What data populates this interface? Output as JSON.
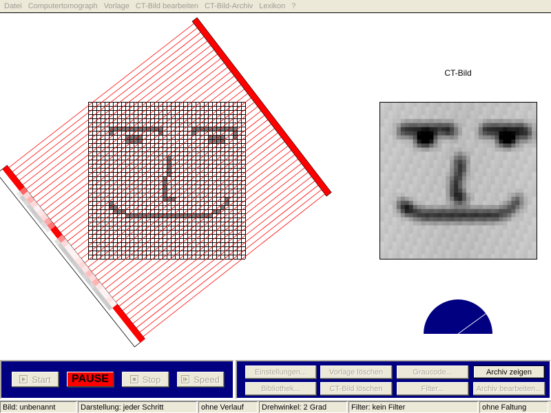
{
  "menu": [
    "Datei",
    "Computertomograph",
    "Vorlage",
    "CT-Bild bearbeiten",
    "CT-Bild-Archiv",
    "Lexikon",
    "?"
  ],
  "ct_title": "CT-Bild",
  "colors": {
    "ray": "#ff0000",
    "emitter": "#ff0000",
    "panel": "#000080",
    "grid_fill": "#808080",
    "gauge": "#000080"
  },
  "scanner": {
    "rotation_angle_deg": 2,
    "grid_size": 38,
    "face_pixels": [
      [
        6,
        5
      ],
      [
        6,
        6
      ],
      [
        6,
        7
      ],
      [
        6,
        8
      ],
      [
        6,
        9
      ],
      [
        6,
        10
      ],
      [
        6,
        11
      ],
      [
        6,
        12
      ],
      [
        6,
        13
      ],
      [
        6,
        14
      ],
      [
        6,
        15
      ],
      [
        6,
        16
      ],
      [
        6,
        17
      ],
      [
        7,
        5
      ],
      [
        7,
        17
      ],
      [
        8,
        9
      ],
      [
        8,
        10
      ],
      [
        8,
        11
      ],
      [
        9,
        9
      ],
      [
        9,
        10
      ],
      [
        9,
        11
      ],
      [
        9,
        12
      ],
      [
        8,
        12
      ],
      [
        6,
        25
      ],
      [
        6,
        26
      ],
      [
        6,
        27
      ],
      [
        6,
        28
      ],
      [
        6,
        29
      ],
      [
        6,
        30
      ],
      [
        6,
        31
      ],
      [
        6,
        32
      ],
      [
        6,
        33
      ],
      [
        6,
        34
      ],
      [
        6,
        35
      ],
      [
        7,
        25
      ],
      [
        7,
        35
      ],
      [
        8,
        35
      ],
      [
        8,
        29
      ],
      [
        8,
        30
      ],
      [
        8,
        31
      ],
      [
        8,
        32
      ],
      [
        9,
        29
      ],
      [
        9,
        30
      ],
      [
        9,
        31
      ],
      [
        9,
        32
      ],
      [
        13,
        19
      ],
      [
        14,
        19
      ],
      [
        15,
        19
      ],
      [
        16,
        19
      ],
      [
        17,
        19
      ],
      [
        18,
        18
      ],
      [
        19,
        18
      ],
      [
        20,
        18
      ],
      [
        21,
        18
      ],
      [
        22,
        18
      ],
      [
        23,
        18
      ],
      [
        23,
        19
      ],
      [
        23,
        20
      ],
      [
        24,
        5
      ],
      [
        25,
        5
      ],
      [
        25,
        6
      ],
      [
        26,
        6
      ],
      [
        26,
        7
      ],
      [
        26,
        8
      ],
      [
        27,
        9
      ],
      [
        27,
        10
      ],
      [
        27,
        11
      ],
      [
        27,
        12
      ],
      [
        27,
        13
      ],
      [
        27,
        14
      ],
      [
        27,
        15
      ],
      [
        27,
        16
      ],
      [
        27,
        17
      ],
      [
        27,
        18
      ],
      [
        27,
        19
      ],
      [
        27,
        20
      ],
      [
        27,
        21
      ],
      [
        27,
        22
      ],
      [
        27,
        23
      ],
      [
        27,
        24
      ],
      [
        27,
        25
      ],
      [
        27,
        26
      ],
      [
        27,
        27
      ],
      [
        27,
        28
      ],
      [
        27,
        29
      ],
      [
        23,
        33
      ],
      [
        24,
        33
      ],
      [
        25,
        32
      ],
      [
        26,
        31
      ],
      [
        26,
        30
      ]
    ],
    "detector_intensity": [
      1,
      1,
      1,
      1,
      1,
      0.6,
      0.15,
      0.3,
      0.15,
      0.05,
      0.1,
      0.15,
      0.35,
      0.55,
      1,
      1,
      0.45,
      0.15,
      0.05,
      0.05,
      0.05,
      0.1,
      0.15,
      0.1,
      0.25,
      0.15,
      0.3,
      0.1,
      0.05,
      0.05,
      0.1,
      0.05,
      1,
      1,
      1,
      1,
      1,
      1,
      1,
      1
    ]
  },
  "gauge": {
    "progress_fraction": 0.2
  },
  "controls": {
    "start": "Start",
    "pause": "PAUSE",
    "stop": "Stop",
    "speed": "Speed",
    "einstellungen": "Einstellungen...",
    "vorlage_loeschen": "Vorlage löschen",
    "graucode": "Graucode...",
    "archiv_zeigen": "Archiv zeigen",
    "bibliothek": "Bibliothek...",
    "ct_bild_loeschen": "CT-Bild löschen",
    "filter": "Filter...",
    "archiv_bearbeiten": "Archiv bearbeiten..."
  },
  "status": {
    "bild": "Bild: unbenannt",
    "darstellung": "Darstellung: jeder Schritt",
    "verlauf": "ohne Verlauf",
    "drehwinkel": "Drehwinkel: 2 Grad",
    "filter": "Filter: kein Filter",
    "faltung": "ohne Faltung"
  }
}
